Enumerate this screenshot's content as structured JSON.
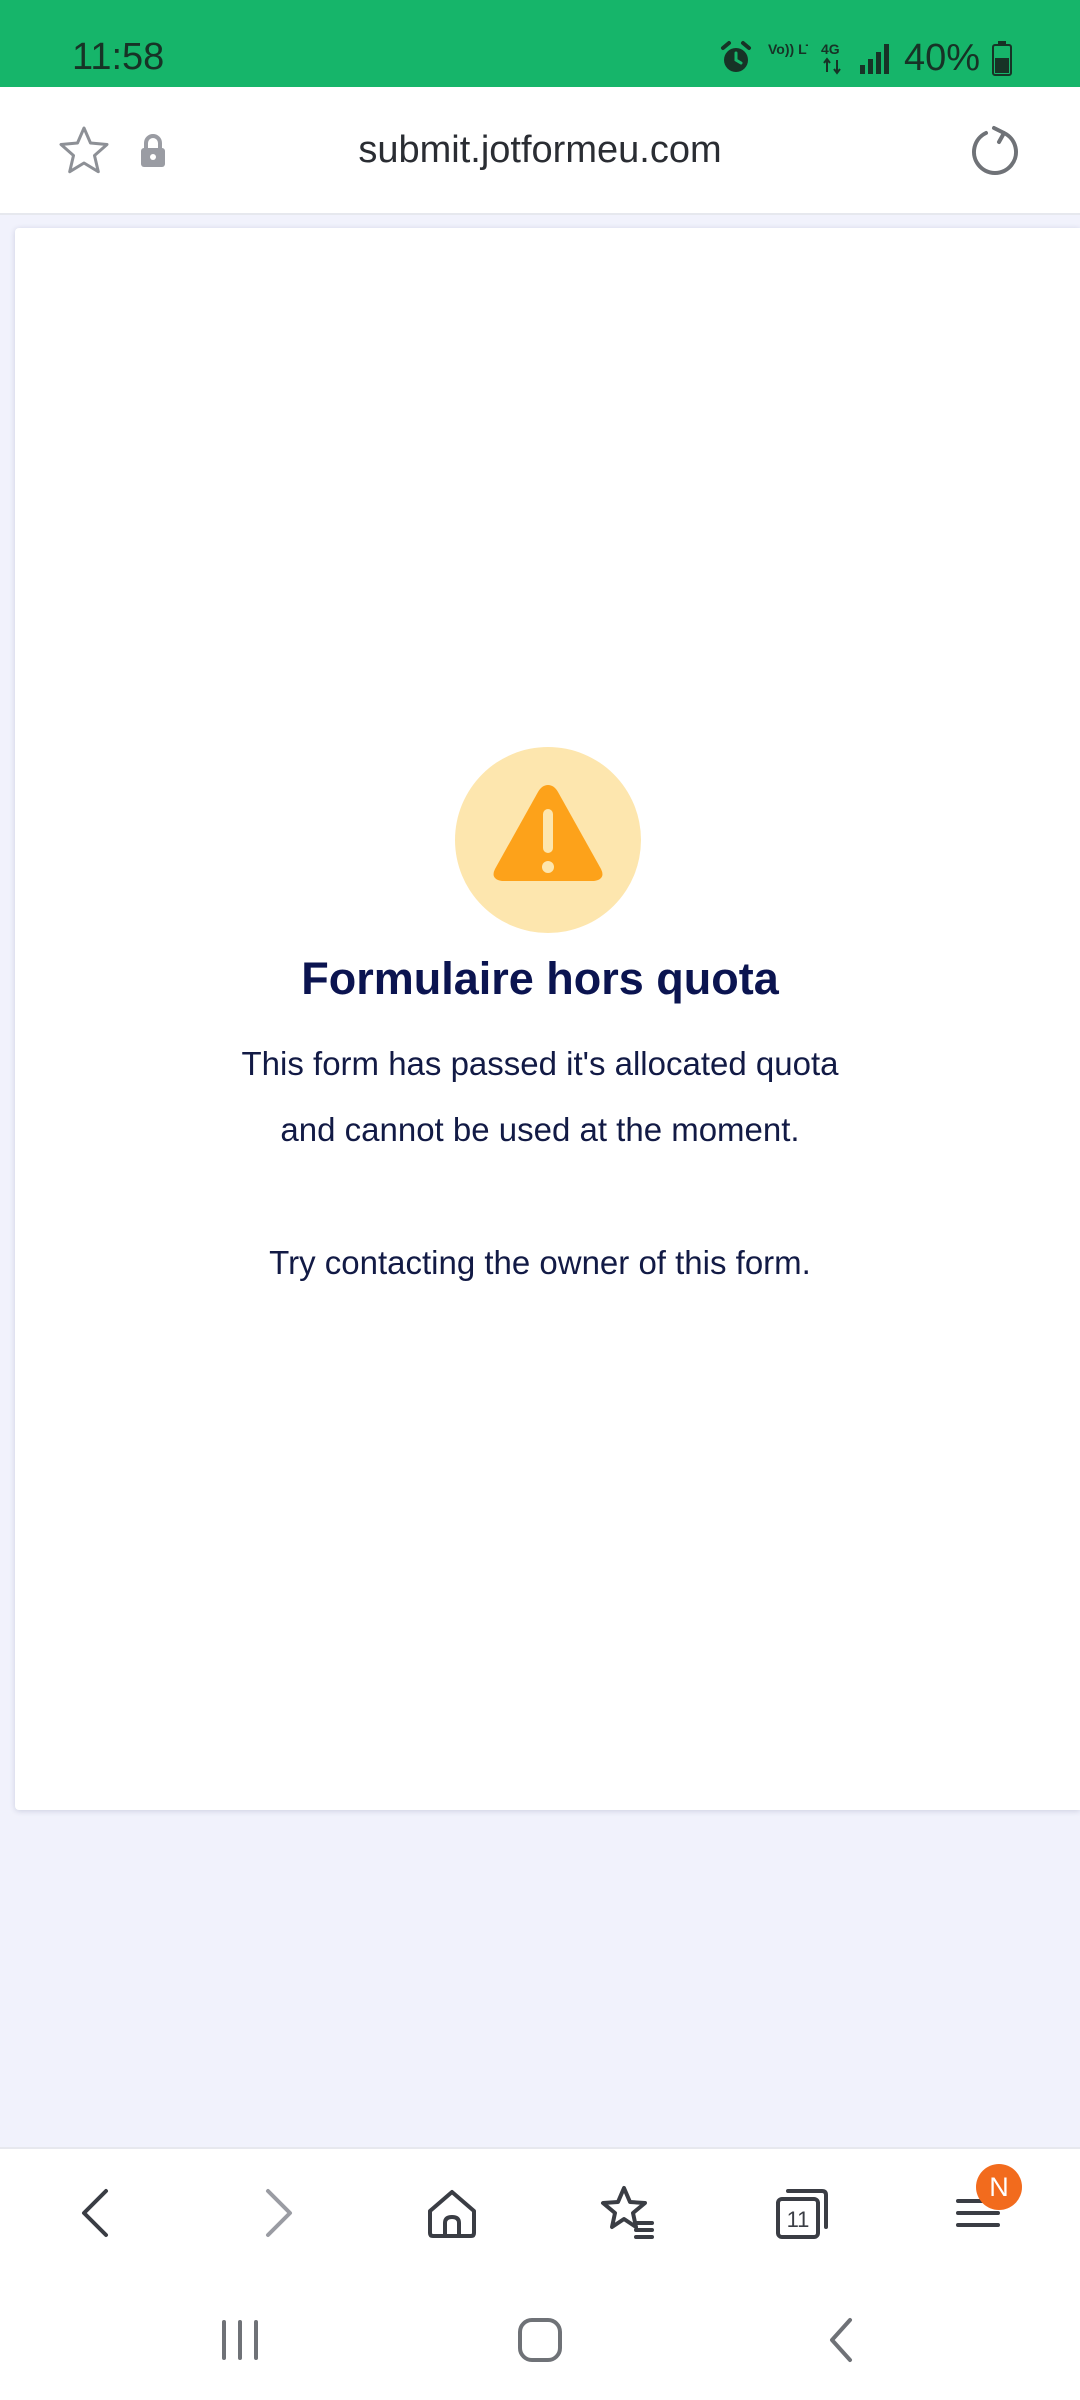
{
  "status_bar": {
    "time": "11:58",
    "battery_text": "40%",
    "icons": [
      "alarm-icon",
      "volte-icon",
      "4g-icon",
      "signal-icon",
      "battery-icon"
    ],
    "volte_label": "Vo)) LTE1",
    "network_label": "4G"
  },
  "browser": {
    "url": "submit.jotformeu.com",
    "icons": [
      "star-icon",
      "lock-icon",
      "reload-icon"
    ]
  },
  "page": {
    "heading": "Formulaire hors quota",
    "line1": "This form has passed it's allocated quota",
    "line2": "and cannot be used at the moment.",
    "line3": "Try contacting the owner of this form.",
    "icon": "warning-icon"
  },
  "bottom_nav": {
    "items": [
      "back-icon",
      "forward-icon",
      "home-icon",
      "bookmarks-icon",
      "tabs-icon",
      "menu-icon"
    ],
    "tabs_count": "11",
    "menu_badge": "N"
  },
  "system_nav": {
    "items": [
      "recents-icon",
      "home-button-icon",
      "system-back-icon"
    ]
  },
  "colors": {
    "status_bar": "#16b56a",
    "page_background": "#f1f2fc",
    "heading": "#0b1450",
    "warning_orange": "#fda21a",
    "warning_circle": "#fde6ae",
    "badge": "#f26b1d"
  }
}
